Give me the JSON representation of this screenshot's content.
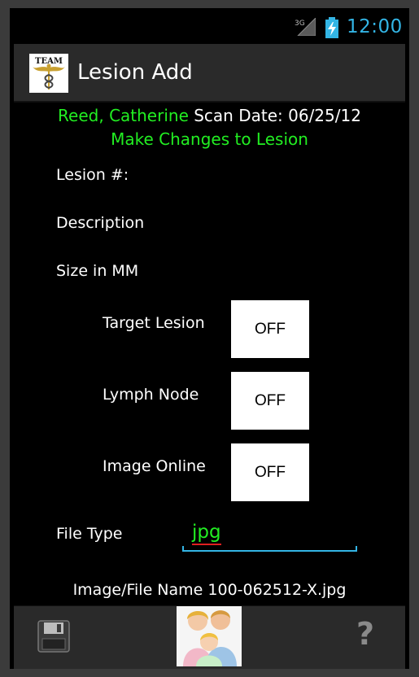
{
  "status_bar": {
    "network_label": "3G",
    "time": "12:00",
    "accent_color": "#33b5e5"
  },
  "action_bar": {
    "logo_text": "TEAM",
    "title": "Lesion Add"
  },
  "header": {
    "patient_name": "Reed, Catherine",
    "scan_date": "Scan Date: 06/25/12",
    "subtitle": "Make Changes to Lesion",
    "highlight_color": "#22ee22"
  },
  "form": {
    "lesion_number_label": "Lesion #:",
    "description_label": "Description",
    "size_label": "Size in MM",
    "toggles": [
      {
        "label": "Target Lesion",
        "value": "OFF"
      },
      {
        "label": "Lymph Node",
        "value": "OFF"
      },
      {
        "label": "Image Online",
        "value": "OFF"
      }
    ],
    "file_type_label": "File Type",
    "file_type_value": "jpg",
    "file_name_line": "Image/File Name 100-062512-X.jpg"
  },
  "bottom_bar": {
    "save_icon": "floppy-disk-icon",
    "family_image": "family-icon",
    "help_label": "?"
  }
}
